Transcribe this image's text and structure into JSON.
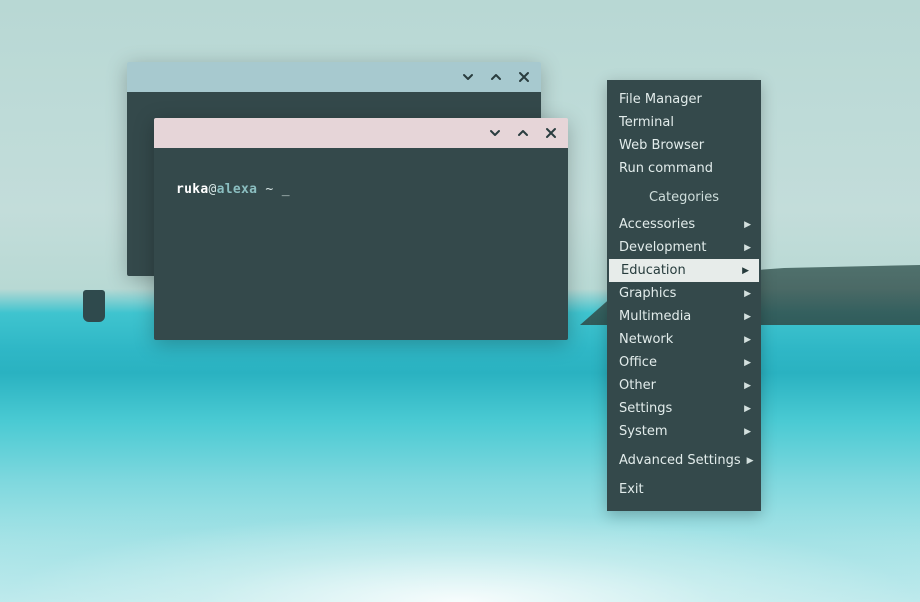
{
  "terminal": {
    "user": "ruka",
    "at": "@",
    "host": "alexa",
    "tail": " ~ ",
    "cursor": "_"
  },
  "menu": {
    "apps": [
      {
        "label": "File Manager"
      },
      {
        "label": "Terminal"
      },
      {
        "label": "Web Browser"
      },
      {
        "label": "Run command"
      }
    ],
    "categories_label": "Categories",
    "categories": [
      {
        "label": "Accessories",
        "submenu": true,
        "highlight": false
      },
      {
        "label": "Development",
        "submenu": true,
        "highlight": false
      },
      {
        "label": "Education",
        "submenu": true,
        "highlight": true
      },
      {
        "label": "Graphics",
        "submenu": true,
        "highlight": false
      },
      {
        "label": "Multimedia",
        "submenu": true,
        "highlight": false
      },
      {
        "label": "Network",
        "submenu": true,
        "highlight": false
      },
      {
        "label": "Office",
        "submenu": true,
        "highlight": false
      },
      {
        "label": "Other",
        "submenu": true,
        "highlight": false
      },
      {
        "label": "Settings",
        "submenu": true,
        "highlight": false
      },
      {
        "label": "System",
        "submenu": true,
        "highlight": false
      }
    ],
    "advanced": {
      "label": "Advanced Settings",
      "submenu": true
    },
    "exit": {
      "label": "Exit"
    }
  },
  "colors": {
    "panel": "#34494b",
    "titlebar_inactive": "#a7c9cf",
    "titlebar_active": "#e6d5d8",
    "menu_highlight_bg": "#e7ecea",
    "menu_highlight_fg": "#263b3c"
  }
}
